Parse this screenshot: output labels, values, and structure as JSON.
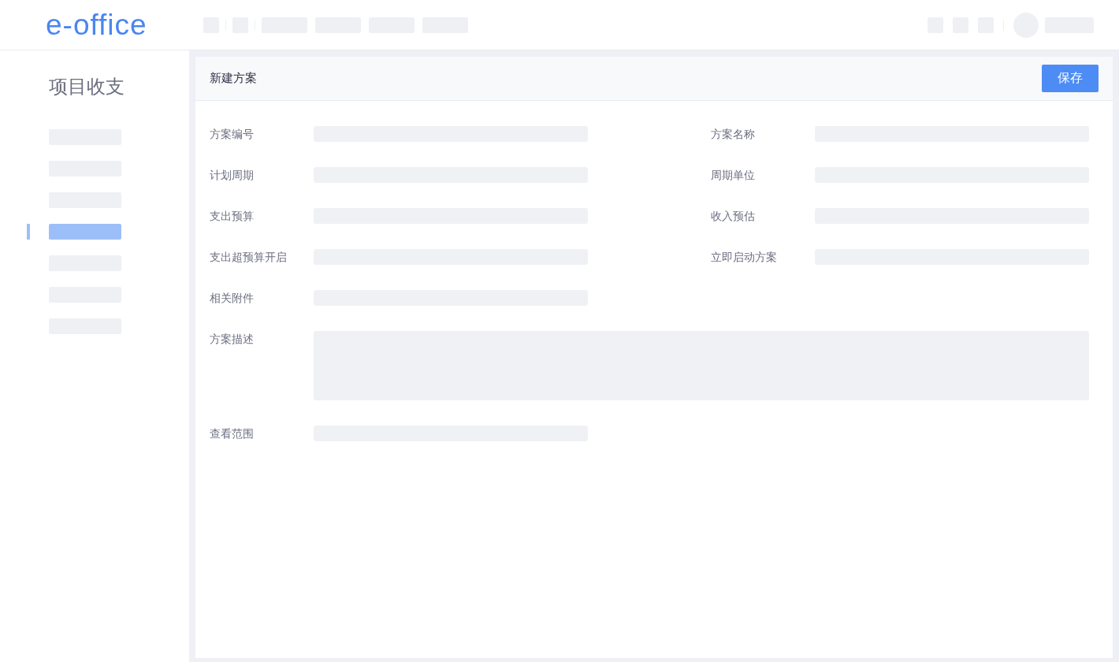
{
  "header": {
    "logo": "e-office"
  },
  "sidebar": {
    "title": "项目收支",
    "items": [
      {
        "selected": false
      },
      {
        "selected": false
      },
      {
        "selected": false
      },
      {
        "selected": true
      },
      {
        "selected": false
      },
      {
        "selected": false
      },
      {
        "selected": false
      }
    ]
  },
  "panel": {
    "title": "新建方案",
    "save_button": "保存",
    "fields": [
      {
        "label": "方案编号",
        "kind": "input"
      },
      {
        "label": "方案名称",
        "kind": "input"
      },
      {
        "label": "计划周期",
        "kind": "input"
      },
      {
        "label": "周期单位",
        "kind": "input"
      },
      {
        "label": "支出预算",
        "kind": "input"
      },
      {
        "label": "收入预估",
        "kind": "input"
      },
      {
        "label": "支出超预算开启",
        "kind": "input"
      },
      {
        "label": "立即启动方案",
        "kind": "input"
      },
      {
        "label": "相关附件",
        "kind": "input"
      },
      {
        "label": "方案描述",
        "kind": "textarea"
      },
      {
        "label": "查看范围",
        "kind": "input"
      }
    ]
  }
}
